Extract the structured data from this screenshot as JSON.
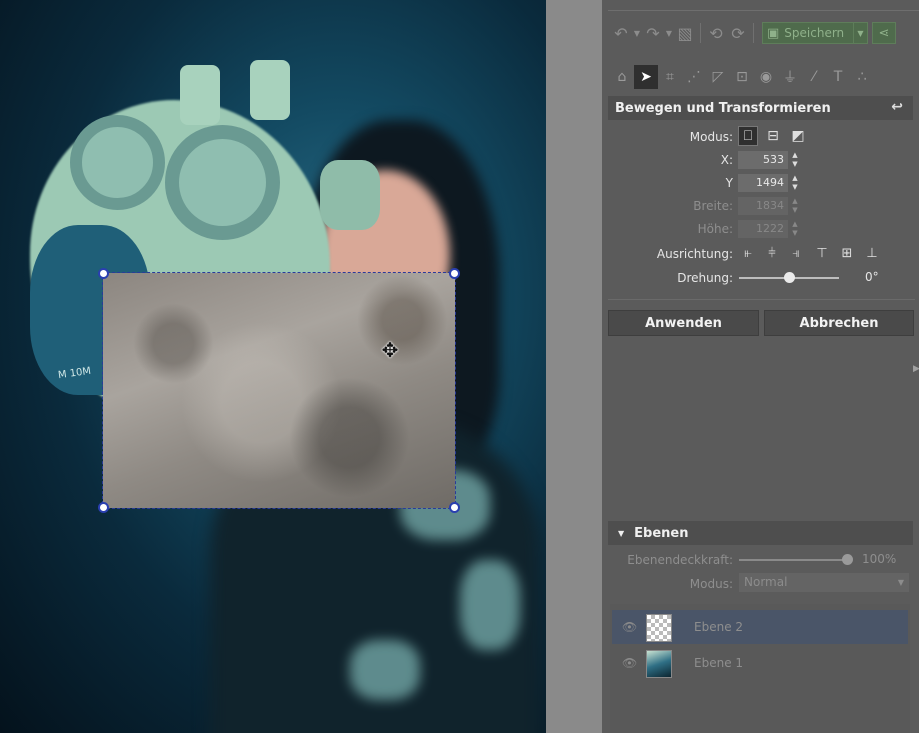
{
  "canvas": {
    "mask_label": "M 10M"
  },
  "toolbar": {
    "undo_icon": "undo-icon",
    "redo_icon": "redo-icon",
    "save_label": "Speichern"
  },
  "tools": {
    "items": [
      "home-icon",
      "select-icon",
      "crop-icon",
      "straighten-icon",
      "perspective-icon",
      "export-icon",
      "eye-icon",
      "stamp-icon",
      "brush-icon",
      "text-icon",
      "effects-icon"
    ]
  },
  "transform": {
    "title": "Bewegen und Transformieren",
    "mode_label": "Modus:",
    "x_label": "X:",
    "x_value": "533",
    "y_label": "Y",
    "y_value": "1494",
    "width_label": "Breite:",
    "width_value": "1834",
    "height_label": "Höhe:",
    "height_value": "1222",
    "align_label": "Ausrichtung:",
    "rotation_label": "Drehung:",
    "rotation_value": "0°",
    "rotation_fraction": 0.5
  },
  "actions": {
    "apply_label": "Anwenden",
    "cancel_label": "Abbrechen"
  },
  "layers": {
    "title": "Ebenen",
    "opacity_label": "Ebenendeckkraft:",
    "opacity_value": "100%",
    "opacity_fraction": 1.0,
    "mode_label": "Modus:",
    "mode_value": "Normal",
    "items": [
      {
        "name": "Ebene 2",
        "selected": true
      },
      {
        "name": "Ebene 1",
        "selected": false
      }
    ]
  },
  "colors": {
    "panel_bg": "#5b5b5b",
    "save_green": "#4f6b4c",
    "selection_blue": "#2a3fb0",
    "layer_selected": "#4a5568"
  }
}
